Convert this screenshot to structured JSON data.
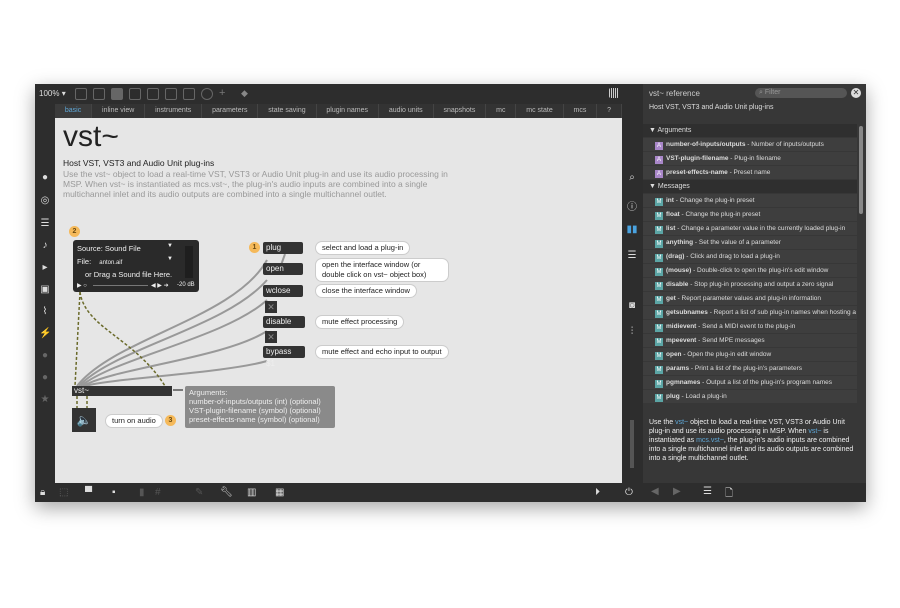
{
  "toolbar": {
    "zoom": "100%"
  },
  "tabs": [
    "basic",
    "inline view",
    "instruments",
    "parameters",
    "state saving",
    "plugin names",
    "audio units",
    "snapshots",
    "mc",
    "mc state",
    "mcs",
    "?"
  ],
  "patch": {
    "title": "vst~",
    "subtitle": "Host VST, VST3 and Audio Unit plug-ins",
    "description": "Use the vst~ object to load a real-time VST, VST3 or Audio Unit plug-in and use its audio processing in MSP. When vst~ is instantiated as mcs.vst~, the plug-in's audio inputs are combined into a single multichannel inlet and its audio outputs are combined into a single multichannel outlet.",
    "player": {
      "source": "Source: Sound File",
      "file_label": "File:",
      "file": "anton.aif",
      "drag": "or Drag a Sound file Here.",
      "level": "-20 dB"
    },
    "messages": [
      {
        "label": "plug",
        "comment": "select and load a plug-in"
      },
      {
        "label": "open",
        "comment": "open the interface window (or double click on vst~ object box)"
      },
      {
        "label": "wclose",
        "comment": "close the interface window"
      },
      {
        "label": "disable $1",
        "comment": "mute effect processing"
      },
      {
        "label": "bypass $1",
        "comment": "mute effect and echo input to output"
      }
    ],
    "badges": [
      "1",
      "2",
      "3"
    ],
    "object": "vst~",
    "arguments": [
      "Arguments:",
      "number-of-inputs/outputs (int) (optional)",
      "VST-plugin-filename (symbol) (optional)",
      "preset-effects-name (symbol) (optional)"
    ],
    "audio_comment": "turn on audio"
  },
  "reference": {
    "title": "vst~ reference",
    "filter_placeholder": "Filter",
    "subtitle": "Host VST, VST3 and Audio Unit plug-ins",
    "arguments_header": "Arguments",
    "arguments": [
      {
        "name": "number-of-inputs/outputs",
        "desc": " - Number of inputs/outputs"
      },
      {
        "name": "VST-plugin-filename",
        "desc": " - Plug-in filename"
      },
      {
        "name": "preset-effects-name",
        "desc": " - Preset name"
      }
    ],
    "messages_header": "Messages",
    "messages": [
      {
        "name": "int",
        "desc": " - Change the plug-in preset"
      },
      {
        "name": "float",
        "desc": " - Change the plug-in preset"
      },
      {
        "name": "list",
        "desc": " - Change a parameter value in the currently loaded plug-in"
      },
      {
        "name": "anything",
        "desc": " - Set the value of a parameter"
      },
      {
        "name": "(drag)",
        "desc": " - Click and drag to load a plug-in"
      },
      {
        "name": "(mouse)",
        "desc": " - Double-click to open the plug-in's edit window"
      },
      {
        "name": "disable",
        "desc": " - Stop plug-in processing and output a zero signal"
      },
      {
        "name": "get",
        "desc": " - Report parameter values and plug-in information"
      },
      {
        "name": "getsubnames",
        "desc": " - Report a list of sub plug-in names when hosting a V..."
      },
      {
        "name": "midievent",
        "desc": " - Send a MIDI event to the plug-in"
      },
      {
        "name": "mpeevent",
        "desc": " - Send MPE messages"
      },
      {
        "name": "open",
        "desc": " - Open the plug-in edit window"
      },
      {
        "name": "params",
        "desc": " - Print a list of the plug-in's parameters"
      },
      {
        "name": "pgmnames",
        "desc": " - Output a list of the plug-in's program names"
      },
      {
        "name": "plug",
        "desc": " - Load a plug-in"
      }
    ],
    "desc": {
      "p1": "Use the ",
      "l1": "vst~",
      "p2": " object to load a real-time VST, VST3 or Audio Unit plug-in and use its audio processing in MSP. When ",
      "l2": "vst~",
      "p3": " is instantiated as ",
      "l3": "mcs.vst~",
      "p4": ", the plug-in's audio inputs are combined into a single multichannel inlet and its audio outputs are combined into a single multichannel outlet."
    }
  }
}
